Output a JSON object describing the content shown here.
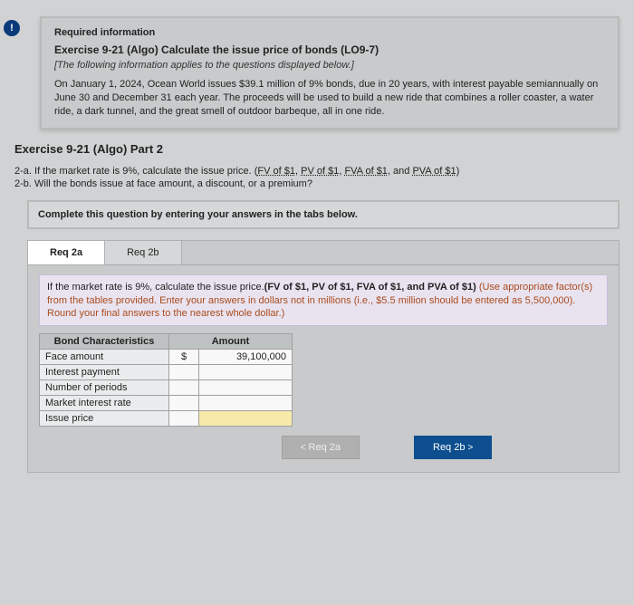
{
  "badge": "!",
  "required_heading": "Required information",
  "exercise_title": "Exercise 9-21 (Algo) Calculate the issue price of bonds (LO9-7)",
  "italic_note": "[The following information applies to the questions displayed below.]",
  "scenario": "On January 1, 2024, Ocean World issues $39.1 million of 9% bonds, due in 20 years, with interest payable semiannually on June 30 and December 31 each year. The proceeds will be used to build a new ride that combines a roller coaster, a water ride, a dark tunnel, and the great smell of outdoor barbeque, all in one ride.",
  "part_heading": "Exercise 9-21 (Algo) Part 2",
  "q_a_prefix": "2-a. If the market rate is 9%, calculate the issue price. (",
  "links": {
    "fv": "FV of $1",
    "pv": "PV of $1",
    "fva": "FVA of $1",
    "pva": "PVA of $1"
  },
  "q_a_suffix": ")",
  "q_b": "2-b. Will the bonds issue at face amount, a discount, or a premium?",
  "instruction": "Complete this question by entering your answers in the tabs below.",
  "tabs": {
    "a": "Req 2a",
    "b": "Req 2b"
  },
  "tab_instr": {
    "main": "If the market rate is 9%, calculate the issue price.",
    "bold_refs": "(FV of $1, PV of $1, FVA of $1, and PVA of $1)",
    "hint": " (Use appropriate factor(s) from the tables provided. Enter your answers in dollars not in millions (i.e., $5.5 million should be entered as 5,500,000). Round your final answers to the nearest whole dollar.)"
  },
  "table": {
    "headers": {
      "char": "Bond Characteristics",
      "amount": "Amount"
    },
    "rows": [
      {
        "label": "Face amount",
        "sym": "$",
        "value": "39,100,000"
      },
      {
        "label": "Interest payment",
        "sym": "",
        "value": ""
      },
      {
        "label": "Number of periods",
        "sym": "",
        "value": ""
      },
      {
        "label": "Market interest rate",
        "sym": "",
        "value": ""
      },
      {
        "label": "Issue price",
        "sym": "",
        "value": "",
        "hl": true
      }
    ]
  },
  "nav": {
    "prev": "Req 2a",
    "next": "Req 2b"
  }
}
